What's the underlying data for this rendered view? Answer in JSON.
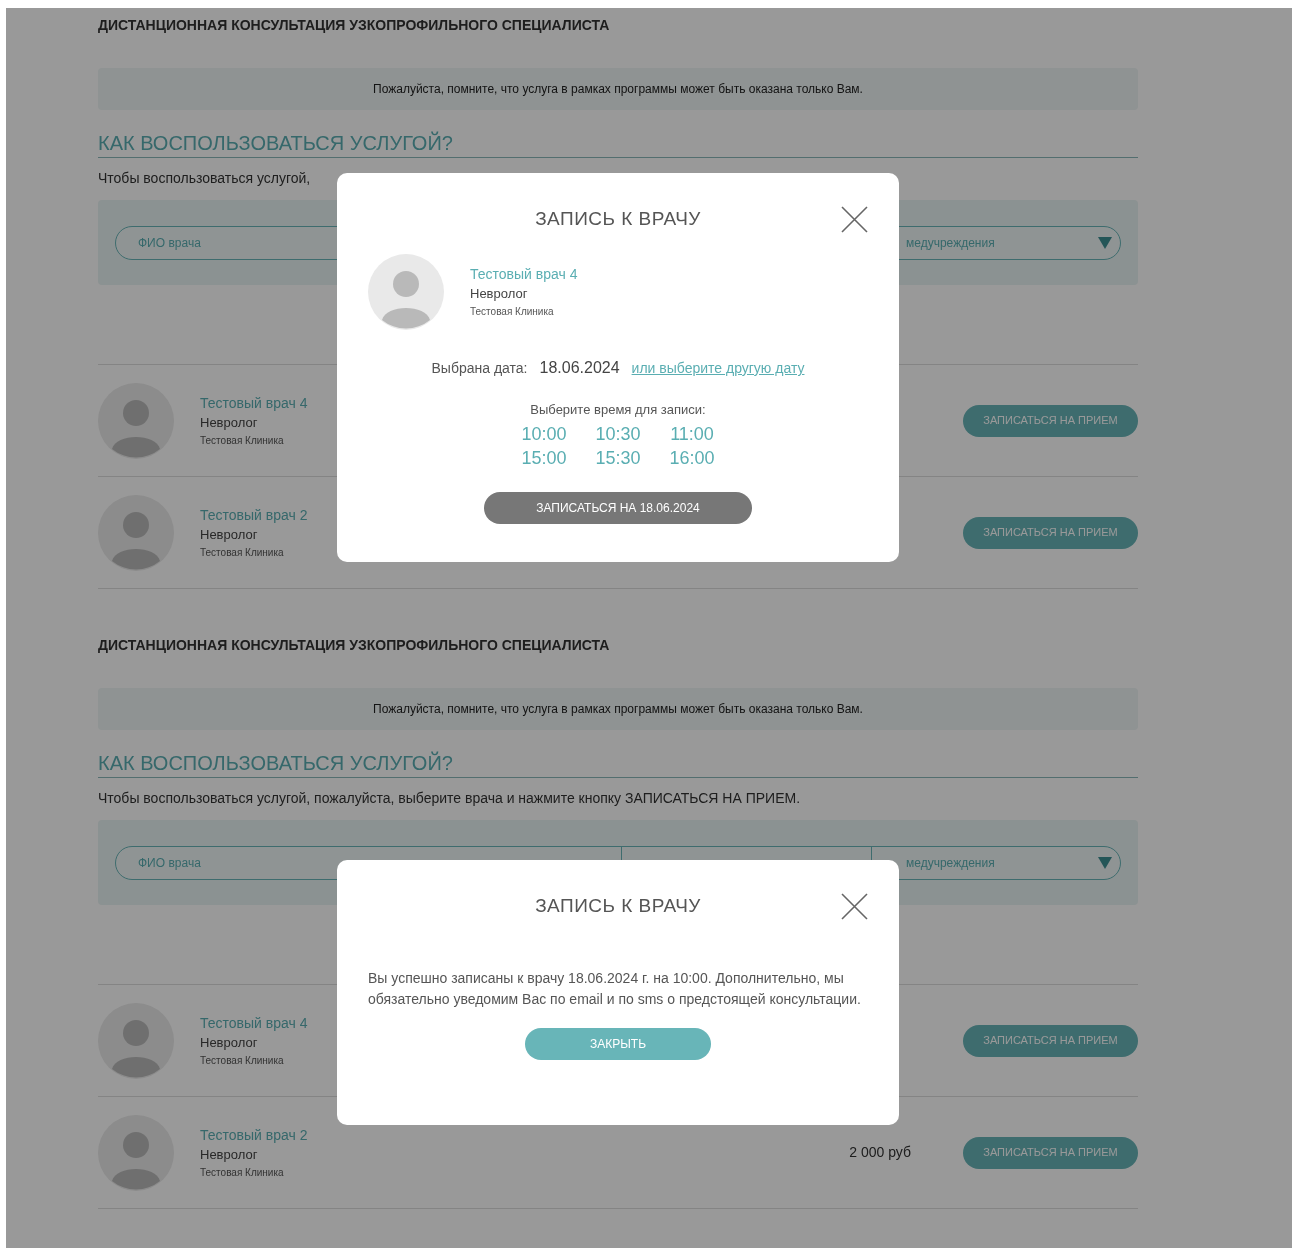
{
  "screens": [
    {
      "page": {
        "title": "ДИСТАНЦИОННАЯ КОНСУЛЬТАЦИЯ УЗКОПРОФИЛЬНОГО СПЕЦИАЛИСТА",
        "notice": "Пожалуйста, помните, что услуга в рамках программы может быть оказана только Вам.",
        "heading": "КАК ВОСПОЛЬЗОВАТЬСЯ УСЛУГОЙ?",
        "intro": "Чтобы воспользоваться услугой,",
        "filters": {
          "doctor_placeholder": "ФИО врача",
          "clinic_placeholder": "медучреждения"
        },
        "doctors": [
          {
            "name": "Тестовый врач 4",
            "specialty": "Невролог",
            "clinic": "Тестовая Клиника",
            "button": "ЗАПИСАТЬСЯ НА ПРИЕМ"
          },
          {
            "name": "Тестовый врач 2",
            "specialty": "Невролог",
            "clinic": "Тестовая Клиника",
            "button": "ЗАПИСАТЬСЯ НА ПРИЕМ"
          }
        ]
      },
      "modal": {
        "kind": "booking",
        "title": "ЗАПИСЬ К ВРАЧУ",
        "doctor": {
          "name": "Тестовый врач 4",
          "specialty": "Невролог",
          "clinic": "Тестовая Клиника"
        },
        "date_label": "Выбрана дата:",
        "date": "18.06.2024",
        "change_date_link": "или выберите другую дату",
        "time_prompt": "Выберите время для записи:",
        "times": [
          "10:00",
          "10:30",
          "11:00",
          "15:00",
          "15:30",
          "16:00"
        ],
        "submit": {
          "label": "ЗАПИСАТЬСЯ НА 18.06.2024",
          "disabled": true
        }
      }
    },
    {
      "page": {
        "title": "ДИСТАНЦИОННАЯ КОНСУЛЬТАЦИЯ УЗКОПРОФИЛЬНОГО СПЕЦИАЛИСТА",
        "notice": "Пожалуйста, помните, что услуга в рамках программы может быть оказана только Вам.",
        "heading": "КАК ВОСПОЛЬЗОВАТЬСЯ УСЛУГОЙ?",
        "intro": "Чтобы воспользоваться услугой, пожалуйста, выберите врача и нажмите кнопку ЗАПИСАТЬСЯ НА ПРИЕМ.",
        "filters": {
          "doctor_placeholder": "ФИО врача",
          "clinic_placeholder": "медучреждения"
        },
        "doctors": [
          {
            "name": "Тестовый врач 4",
            "specialty": "Невролог",
            "clinic": "Тестовая Клиника",
            "button": "ЗАПИСАТЬСЯ НА ПРИЕМ"
          },
          {
            "name": "Тестовый врач 2",
            "specialty": "Невролог",
            "clinic": "Тестовая Клиника",
            "price": "2 000 руб",
            "button": "ЗАПИСАТЬСЯ НА ПРИЕМ"
          }
        ]
      },
      "modal": {
        "kind": "confirmation",
        "title": "ЗАПИСЬ К ВРАЧУ",
        "message": "Вы успешно записаны к врачу 18.06.2024 г. на 10:00. Дополнительно, мы обязательно уведомим Вас по email и по sms о предстоящей консультации.",
        "button": "ЗАКРЫТЬ"
      }
    }
  ]
}
